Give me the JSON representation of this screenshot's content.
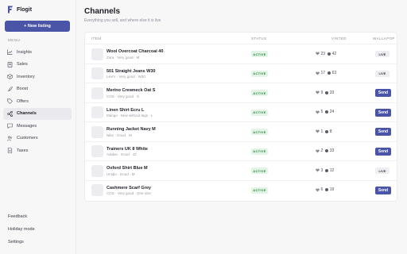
{
  "brand": {
    "name": "Flogit"
  },
  "sidebar": {
    "new_button": "+ New listing",
    "menu_label": "MENU",
    "items": [
      {
        "label": "Insights",
        "icon": "chart-icon"
      },
      {
        "label": "Sales",
        "icon": "receipt-icon"
      },
      {
        "label": "Inventory",
        "icon": "box-icon"
      },
      {
        "label": "Boost",
        "icon": "rocket-icon"
      },
      {
        "label": "Offers",
        "icon": "tag-icon"
      },
      {
        "label": "Channels",
        "icon": "share-icon"
      },
      {
        "label": "Messages",
        "icon": "chat-icon"
      },
      {
        "label": "Customers",
        "icon": "users-icon"
      },
      {
        "label": "Taxes",
        "icon": "document-icon"
      }
    ],
    "active": "Channels",
    "footer": [
      "Feedback",
      "Holiday mode",
      "Settings"
    ]
  },
  "header": {
    "title": "Channels",
    "subtitle": "Everything you sell, and where else it is live"
  },
  "table": {
    "columns": [
      "ITEM",
      "STATUS",
      "VINTED",
      "WALLAPOP"
    ],
    "rows": [
      {
        "name": "Wool Overcoat Charcoal 40",
        "meta": "Zara · Very good · M",
        "status": "ACTIVE",
        "likes": "23",
        "views": "42",
        "action": "LIVE"
      },
      {
        "name": "501 Straight Jeans W30",
        "meta": "Levi's · Very good · W30",
        "status": "ACTIVE",
        "likes": "17",
        "views": "63",
        "action": "LIVE"
      },
      {
        "name": "Merino Crewneck Oat S",
        "meta": "COS · Very good · S",
        "status": "ACTIVE",
        "likes": "9",
        "views": "33",
        "action": "Send"
      },
      {
        "name": "Linen Shirt Ecru L",
        "meta": "Mango · New without tags · L",
        "status": "ACTIVE",
        "likes": "5",
        "views": "24",
        "action": "Send"
      },
      {
        "name": "Running Jacket Navy M",
        "meta": "Nike · Good · M",
        "status": "ACTIVE",
        "likes": "1",
        "views": "8",
        "action": "Send"
      },
      {
        "name": "Trainers UK 8 White",
        "meta": "Adidas · Good · 42",
        "status": "ACTIVE",
        "likes": "2",
        "views": "33",
        "action": "Send"
      },
      {
        "name": "Oxford Shirt Blue M",
        "meta": "Uniqlo · Good · M",
        "status": "ACTIVE",
        "likes": "3",
        "views": "12",
        "action": "LIVE"
      },
      {
        "name": "Cashmere Scarf Grey",
        "meta": "COS · Very good · One size",
        "status": "ACTIVE",
        "likes": "6",
        "views": "19",
        "action": "Send"
      }
    ]
  },
  "colors": {
    "accent": "#4a55a7",
    "active_bg": "#e2f4e6",
    "active_text": "#2f8a43"
  }
}
